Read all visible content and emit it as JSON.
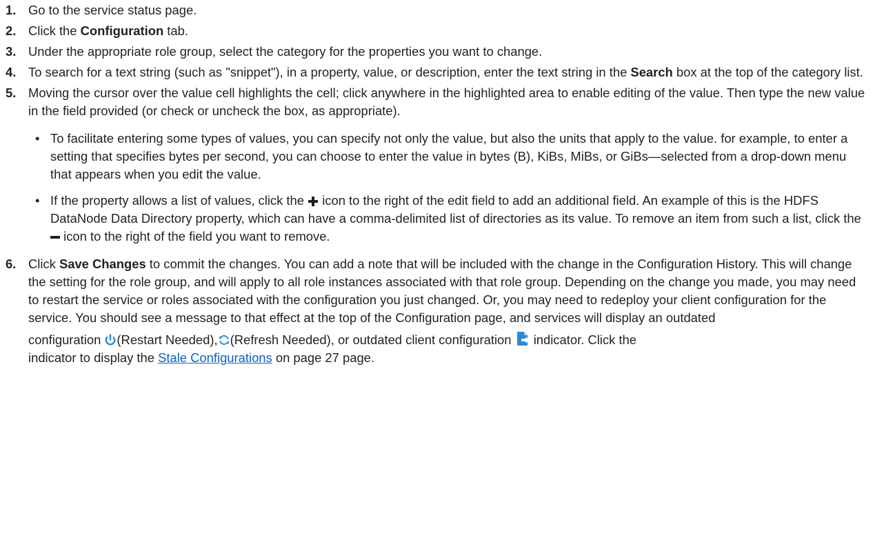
{
  "steps": [
    {
      "num": "1.",
      "text": "Go to the service status page."
    },
    {
      "num": "2.",
      "pre": "Click the ",
      "bold": "Configuration",
      "post": " tab."
    },
    {
      "num": "3.",
      "text": "Under the appropriate role group, select the category for the properties you want to change."
    },
    {
      "num": "4.",
      "pre": "To search for a text string (such as \"snippet\"), in a property, value, or description, enter the text string in the ",
      "bold": "Search",
      "post": " box at the top of the category list."
    },
    {
      "num": "5.",
      "text": "Moving the cursor over the value cell highlights the cell; click anywhere in the highlighted area to enable editing of the value. Then type the new value in the field provided (or check or uncheck the box, as appropriate).",
      "bullets": [
        {
          "text": "To facilitate entering some types of values, you can specify not only the value, but also the units that apply to the value. for example, to enter a setting that specifies bytes per second, you can choose to enter the value in bytes (B), KiBs, MiBs, or GiBs—selected from a drop-down menu that appears when you edit the value."
        },
        {
          "pre": "If the property allows a list of values, click the ",
          "mid": " icon to the right of the edit field to add an additional field. An example of this is the HDFS DataNode Data Directory property, which can have a comma-delimited list of directories as its value. To remove an item from such a list, click the ",
          "post": " icon to the right of the field you want to remove."
        }
      ]
    },
    {
      "num": "6.",
      "pre": "Click ",
      "bold": "Save Changes",
      "body": " to commit the changes. You can add a note that will be included with the change in the Configuration History. This will change the setting for the role group, and will apply to all role instances associated with that role group. Depending on the change you made, you may need to restart the service or roles associated with the configuration you just changed. Or, you may need to redeploy your client configuration for the service. You should see a message to that effect at the top of the Configuration page, and services will display an outdated",
      "line2_pre": "configuration ",
      "restart": "(Restart Needed),",
      "refresh": "(Refresh Needed), or outdated client configuration ",
      "indicator": " indicator. Click the",
      "line3_pre": "indicator to display the ",
      "link": "Stale Configurations",
      "line3_post": " on page 27 page."
    }
  ],
  "icons": {
    "plus": "plus-icon",
    "minus": "minus-icon",
    "restart": "restart-needed-icon",
    "refresh": "refresh-needed-icon",
    "client": "client-config-icon"
  },
  "colors": {
    "text": "#231f20",
    "link": "#0b5fd0",
    "icon_blue": "#2a8ad4"
  }
}
